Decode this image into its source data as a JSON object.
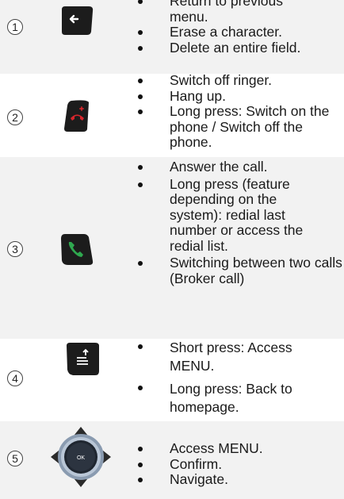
{
  "rows": [
    {
      "number": "1",
      "key_icon": "back-arrow-icon",
      "items": [
        "Return to previous menu.",
        "Erase a character.",
        "Delete an entire field."
      ]
    },
    {
      "number": "2",
      "key_icon": "hang-up-icon",
      "items": [
        "Switch off ringer.",
        "Hang up.",
        "Long press: Switch on the phone / Switch off the phone."
      ]
    },
    {
      "number": "3",
      "key_icon": "answer-call-icon",
      "items": [
        "Answer the call.",
        "Long press (feature depending on the system): redial last number or access the redial list.",
        "Switching between two calls (Broker call)"
      ]
    },
    {
      "number": "4",
      "key_icon": "menu-key-icon",
      "items": [
        "Short press: Access MENU.",
        "Long press: Back to homepage."
      ]
    },
    {
      "number": "5",
      "key_icon": "navigator-ok-icon",
      "items": [
        "Access MENU.",
        "Confirm.",
        "Navigate."
      ],
      "ok_label": "OK"
    }
  ],
  "colors": {
    "row_shade": "#f2f2f2",
    "key_body": "#1c1c1c",
    "hangup_red": "#d8262c",
    "answer_green": "#2fa84f",
    "navigator_ring": "#8a9bb0"
  }
}
